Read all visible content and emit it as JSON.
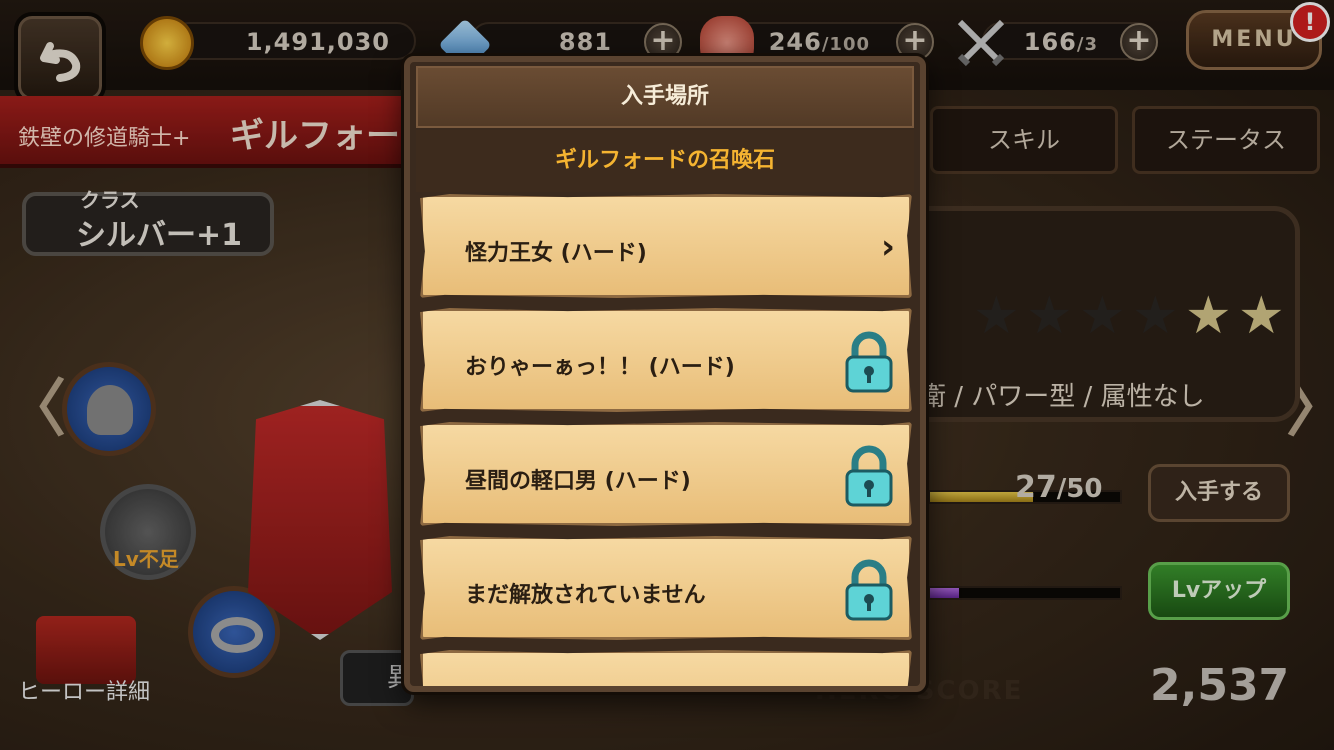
{
  "topbar": {
    "gold": "1,491,030",
    "gems": "881",
    "stamina_current": "246",
    "stamina_max": "/100",
    "battles_current": "166",
    "battles_max": "/3",
    "plus": "+",
    "menu_label": "MENU",
    "menu_badge": "!"
  },
  "hero": {
    "title": "鉄壁の修道騎士+",
    "name": "ギルフォー",
    "class_label": "クラス",
    "class_value": "シルバー+1",
    "lv_warning": "Lv不足",
    "detail_label": "ヒーロー詳細",
    "partial_button": "異"
  },
  "nav": {
    "left_arrow": "〈",
    "right_arrow": "〉"
  },
  "tabs": [
    "スキル",
    "ステータス"
  ],
  "stats": {
    "type_text": "衛 / パワー型 / 属性なし",
    "stars_total": 7,
    "stars_lit": 2,
    "shard_current": "27",
    "shard_max": "/50",
    "shard_fraction": 0.54,
    "exp_fraction": 0.15,
    "obtain_button": "入手する",
    "levelup_button": "Lvアップ",
    "score_label": "HERO SCORE",
    "score": "2,537"
  },
  "colors": {
    "accent_orange": "#f5b431",
    "banner_red": "#a8201c",
    "levelup_green": "#2c7a22"
  },
  "modal": {
    "title": "入手場所",
    "subtitle": "ギルフォードの召喚石",
    "items": [
      {
        "label": "怪力王女 (ハード)",
        "icon": "chevron-right-icon"
      },
      {
        "label": "おりゃーぁっ！！ (ハード)",
        "icon": "lock-icon"
      },
      {
        "label": "昼間の軽口男 (ハード)",
        "icon": "lock-icon"
      },
      {
        "label": "まだ解放されていません",
        "icon": "lock-icon"
      }
    ],
    "chevron": "›"
  }
}
